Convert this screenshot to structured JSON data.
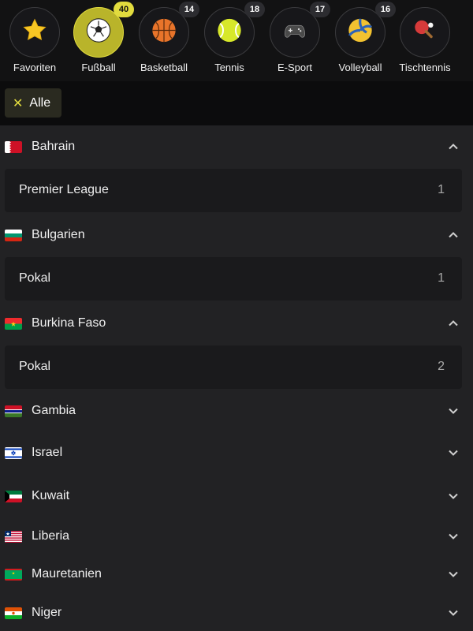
{
  "sports": [
    {
      "label": "Favoriten",
      "icon": "star-icon",
      "badge": ""
    },
    {
      "label": "Fußball",
      "icon": "soccer-ball-icon",
      "badge": "40",
      "active": true
    },
    {
      "label": "Basketball",
      "icon": "basketball-icon",
      "badge": "14"
    },
    {
      "label": "Tennis",
      "icon": "tennis-ball-icon",
      "badge": "18"
    },
    {
      "label": "E-Sport",
      "icon": "gamepad-icon",
      "badge": "17"
    },
    {
      "label": "Volleyball",
      "icon": "volleyball-icon",
      "badge": "16"
    },
    {
      "label": "Tischtennis",
      "icon": "ping-pong-icon",
      "badge": ""
    }
  ],
  "filter": {
    "chip_label": "Alle"
  },
  "countries": [
    {
      "name": "Bahrain",
      "expanded": true,
      "leagues": [
        {
          "name": "Premier League",
          "count": "1"
        }
      ]
    },
    {
      "name": "Bulgarien",
      "expanded": true,
      "leagues": [
        {
          "name": "Pokal",
          "count": "1"
        }
      ]
    },
    {
      "name": "Burkina Faso",
      "expanded": true,
      "leagues": [
        {
          "name": "Pokal",
          "count": "2"
        }
      ]
    },
    {
      "name": "Gambia",
      "expanded": false
    },
    {
      "name": "Israel",
      "expanded": false
    },
    {
      "name": "Kuwait",
      "expanded": false
    },
    {
      "name": "Liberia",
      "expanded": false
    },
    {
      "name": "Mauretanien",
      "expanded": false
    },
    {
      "name": "Niger",
      "expanded": false
    }
  ],
  "colors": {
    "accent": "#e2dc3e",
    "background": "#222224",
    "panel": "#1a1a1c"
  }
}
